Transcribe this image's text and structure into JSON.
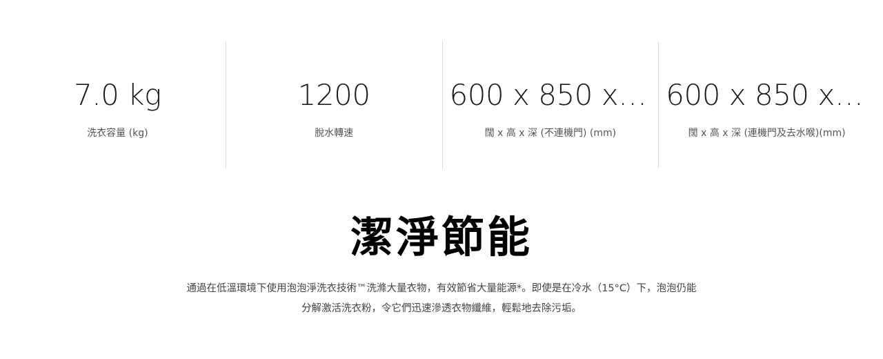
{
  "specs": [
    {
      "value": "7.0 kg",
      "label": "洗衣容量 (kg)"
    },
    {
      "value": "1200",
      "label": "脫水轉速"
    },
    {
      "value": "600 x 850 x ...",
      "label": "闊 x 高 x 深 (不連機門) (mm)"
    },
    {
      "value": "600 x 850 x ...",
      "label": "闊 x 高 x 深 (連機門及去水喉)(mm)"
    }
  ],
  "feature": {
    "title": "潔淨節能",
    "description_lines": [
      "通過在低溫環境下使用泡泡淨洗衣技術™洗滌大量衣物，有效節省大量能源*。即使是在冷水（15°C）下，泡泡仍能",
      "分解激活洗衣粉，令它們迅速滲透衣物纖維，輕鬆地去除污垢。"
    ]
  }
}
